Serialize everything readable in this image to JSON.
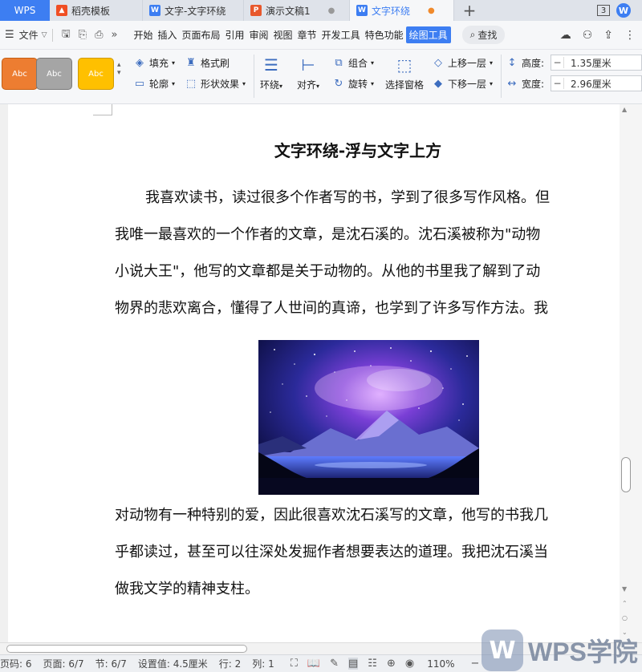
{
  "tabs": {
    "wps": "WPS",
    "items": [
      {
        "label": "稻壳模板",
        "icon": "daoke-icon"
      },
      {
        "label": "文字-文字环绕",
        "icon": "writer-doc-icon"
      },
      {
        "label": "演示文稿1",
        "icon": "presentation-icon"
      },
      {
        "label": "文字环绕",
        "icon": "writer-doc-icon"
      }
    ],
    "add": "+",
    "badge": "3"
  },
  "menubar": {
    "file": "文件",
    "items": [
      "开始",
      "插入",
      "页面布局",
      "引用",
      "审阅",
      "视图",
      "章节",
      "开发工具",
      "特色功能",
      "绘图工具"
    ],
    "active": "绘图工具",
    "search": "查找"
  },
  "ribbon": {
    "styles": [
      "Abc",
      "Abc",
      "Abc"
    ],
    "fill": "填充",
    "format_painter": "格式刷",
    "outline": "轮廓",
    "shape_effect": "形状效果",
    "wrap": "环绕",
    "align": "对齐",
    "group": "组合",
    "rotate": "旋转",
    "selection_pane": "选择窗格",
    "bring_forward": "上移一层",
    "send_backward": "下移一层",
    "height_label": "高度:",
    "height_value": "1.35厘米",
    "width_label": "宽度:",
    "width_value": "2.96厘米"
  },
  "document": {
    "title": "文字环绕-浮与文字上方",
    "lines_before": [
      "我喜欢读书，读过很多个作者写的书，学到了很多写作风格。但",
      "我唯一最喜欢的一个作者的文章，是沈石溪的。沈石溪被称为\"动物",
      "小说大王\"，他写的文章都是关于动物的。从他的书里我了解到了动",
      "物界的悲欢离合，懂得了人世间的真谛，也学到了许多写作方法。我"
    ],
    "lines_after": [
      "对动物有一种特别的爱，因此很喜欢沈石溪写的文章，他写的书我几",
      "乎都读过，甚至可以往深处发掘作者想要表达的道理。我把沈石溪当",
      "做我文学的精神支柱。"
    ]
  },
  "status": {
    "page_code": "页码: 6",
    "page": "页面: 6/7",
    "section": "节: 6/7",
    "setting": "设置值: 4.5厘米",
    "row": "行: 2",
    "col": "列: 1",
    "zoom": "110%"
  },
  "watermark": {
    "logo": "W",
    "text": "WPS学院"
  },
  "colors": {
    "accent": "#3d7ef2"
  }
}
